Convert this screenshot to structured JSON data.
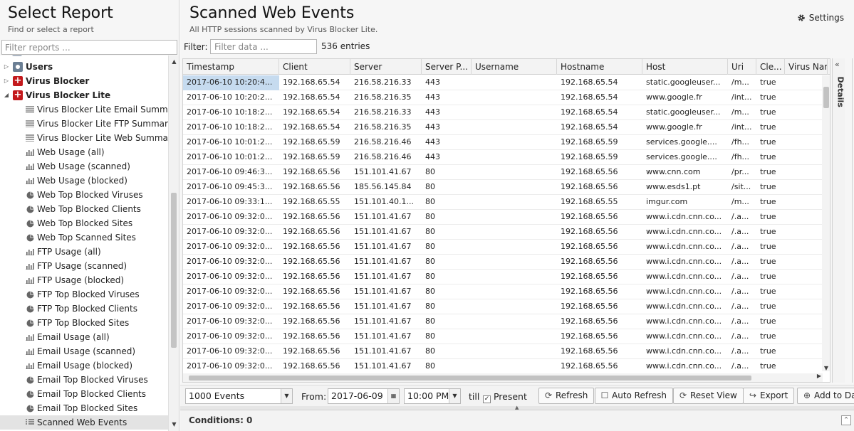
{
  "left": {
    "title": "Select Report",
    "subtitle": "Find or select a report",
    "filter_placeholder": "Filter reports ..."
  },
  "tree": [
    {
      "label": "Users",
      "type": "group",
      "icon": "users-icon",
      "expander": "▷"
    },
    {
      "label": "Virus Blocker",
      "type": "group",
      "icon": "virus-blocker-icon",
      "expander": "▷"
    },
    {
      "label": "Virus Blocker Lite",
      "type": "group",
      "icon": "virus-blocker-icon",
      "expander": "◢"
    },
    {
      "label": "Virus Blocker Lite Email Summary",
      "type": "text",
      "icon": "text-report-icon"
    },
    {
      "label": "Virus Blocker Lite FTP Summary",
      "type": "text",
      "icon": "text-report-icon"
    },
    {
      "label": "Virus Blocker Lite Web Summary",
      "type": "text",
      "icon": "text-report-icon"
    },
    {
      "label": "Web Usage (all)",
      "type": "bar",
      "icon": "bar-chart-icon"
    },
    {
      "label": "Web Usage (scanned)",
      "type": "bar",
      "icon": "bar-chart-icon"
    },
    {
      "label": "Web Usage (blocked)",
      "type": "bar",
      "icon": "bar-chart-icon"
    },
    {
      "label": "Web Top Blocked Viruses",
      "type": "pie",
      "icon": "pie-chart-icon"
    },
    {
      "label": "Web Top Blocked Clients",
      "type": "pie",
      "icon": "pie-chart-icon"
    },
    {
      "label": "Web Top Blocked Sites",
      "type": "pie",
      "icon": "pie-chart-icon"
    },
    {
      "label": "Web Top Scanned Sites",
      "type": "pie",
      "icon": "pie-chart-icon"
    },
    {
      "label": "FTP Usage (all)",
      "type": "bar",
      "icon": "bar-chart-icon"
    },
    {
      "label": "FTP Usage (scanned)",
      "type": "bar",
      "icon": "bar-chart-icon"
    },
    {
      "label": "FTP Usage (blocked)",
      "type": "bar",
      "icon": "bar-chart-icon"
    },
    {
      "label": "FTP Top Blocked Viruses",
      "type": "pie",
      "icon": "pie-chart-icon"
    },
    {
      "label": "FTP Top Blocked Clients",
      "type": "pie",
      "icon": "pie-chart-icon"
    },
    {
      "label": "FTP Top Blocked Sites",
      "type": "pie",
      "icon": "pie-chart-icon"
    },
    {
      "label": "Email Usage (all)",
      "type": "bar",
      "icon": "bar-chart-icon"
    },
    {
      "label": "Email Usage (scanned)",
      "type": "bar",
      "icon": "bar-chart-icon"
    },
    {
      "label": "Email Usage (blocked)",
      "type": "bar",
      "icon": "bar-chart-icon"
    },
    {
      "label": "Email Top Blocked Viruses",
      "type": "pie",
      "icon": "pie-chart-icon"
    },
    {
      "label": "Email Top Blocked Clients",
      "type": "pie",
      "icon": "pie-chart-icon"
    },
    {
      "label": "Email Top Blocked Sites",
      "type": "pie",
      "icon": "pie-chart-icon"
    },
    {
      "label": "Scanned Web Events",
      "type": "list",
      "icon": "list-icon",
      "selected": true
    }
  ],
  "main": {
    "title": "Scanned Web Events",
    "subtitle": "All HTTP sessions scanned by Virus Blocker Lite.",
    "settings_label": "Settings",
    "filter_label": "Filter:",
    "filter_placeholder": "Filter data ...",
    "entries": "536 entries",
    "details_label": "Details"
  },
  "columns": [
    "Timestamp",
    "Client",
    "Server",
    "Server P...",
    "Username",
    "Hostname",
    "Host",
    "Uri",
    "Cle...",
    "Virus Nam"
  ],
  "rows": [
    [
      "2017-06-10 10:20:4...",
      "192.168.65.54",
      "216.58.216.33",
      "443",
      "",
      "192.168.65.54",
      "static.googleuser...",
      "/m...",
      "true",
      ""
    ],
    [
      "2017-06-10 10:20:2...",
      "192.168.65.54",
      "216.58.216.35",
      "443",
      "",
      "192.168.65.54",
      "www.google.fr",
      "/int...",
      "true",
      ""
    ],
    [
      "2017-06-10 10:18:2...",
      "192.168.65.54",
      "216.58.216.33",
      "443",
      "",
      "192.168.65.54",
      "static.googleuser...",
      "/m...",
      "true",
      ""
    ],
    [
      "2017-06-10 10:18:2...",
      "192.168.65.54",
      "216.58.216.35",
      "443",
      "",
      "192.168.65.54",
      "www.google.fr",
      "/int...",
      "true",
      ""
    ],
    [
      "2017-06-10 10:01:2...",
      "192.168.65.59",
      "216.58.216.46",
      "443",
      "",
      "192.168.65.59",
      "services.google....",
      "/fh...",
      "true",
      ""
    ],
    [
      "2017-06-10 10:01:2...",
      "192.168.65.59",
      "216.58.216.46",
      "443",
      "",
      "192.168.65.59",
      "services.google....",
      "/fh...",
      "true",
      ""
    ],
    [
      "2017-06-10 09:46:3...",
      "192.168.65.56",
      "151.101.41.67",
      "80",
      "",
      "192.168.65.56",
      "www.cnn.com",
      "/pr...",
      "true",
      ""
    ],
    [
      "2017-06-10 09:45:3...",
      "192.168.65.56",
      "185.56.145.84",
      "80",
      "",
      "192.168.65.56",
      "www.esds1.pt",
      "/sit...",
      "true",
      ""
    ],
    [
      "2017-06-10 09:33:1...",
      "192.168.65.55",
      "151.101.40.1...",
      "80",
      "",
      "192.168.65.55",
      "imgur.com",
      "/m...",
      "true",
      ""
    ],
    [
      "2017-06-10 09:32:0...",
      "192.168.65.56",
      "151.101.41.67",
      "80",
      "",
      "192.168.65.56",
      "www.i.cdn.cnn.co...",
      "/.a...",
      "true",
      ""
    ],
    [
      "2017-06-10 09:32:0...",
      "192.168.65.56",
      "151.101.41.67",
      "80",
      "",
      "192.168.65.56",
      "www.i.cdn.cnn.co...",
      "/.a...",
      "true",
      ""
    ],
    [
      "2017-06-10 09:32:0...",
      "192.168.65.56",
      "151.101.41.67",
      "80",
      "",
      "192.168.65.56",
      "www.i.cdn.cnn.co...",
      "/.a...",
      "true",
      ""
    ],
    [
      "2017-06-10 09:32:0...",
      "192.168.65.56",
      "151.101.41.67",
      "80",
      "",
      "192.168.65.56",
      "www.i.cdn.cnn.co...",
      "/.a...",
      "true",
      ""
    ],
    [
      "2017-06-10 09:32:0...",
      "192.168.65.56",
      "151.101.41.67",
      "80",
      "",
      "192.168.65.56",
      "www.i.cdn.cnn.co...",
      "/.a...",
      "true",
      ""
    ],
    [
      "2017-06-10 09:32:0...",
      "192.168.65.56",
      "151.101.41.67",
      "80",
      "",
      "192.168.65.56",
      "www.i.cdn.cnn.co...",
      "/.a...",
      "true",
      ""
    ],
    [
      "2017-06-10 09:32:0...",
      "192.168.65.56",
      "151.101.41.67",
      "80",
      "",
      "192.168.65.56",
      "www.i.cdn.cnn.co...",
      "/.a...",
      "true",
      ""
    ],
    [
      "2017-06-10 09:32:0...",
      "192.168.65.56",
      "151.101.41.67",
      "80",
      "",
      "192.168.65.56",
      "www.i.cdn.cnn.co...",
      "/.a...",
      "true",
      ""
    ],
    [
      "2017-06-10 09:32:0...",
      "192.168.65.56",
      "151.101.41.67",
      "80",
      "",
      "192.168.65.56",
      "www.i.cdn.cnn.co...",
      "/.a...",
      "true",
      ""
    ],
    [
      "2017-06-10 09:32:0...",
      "192.168.65.56",
      "151.101.41.67",
      "80",
      "",
      "192.168.65.56",
      "www.i.cdn.cnn.co...",
      "/.a...",
      "true",
      ""
    ],
    [
      "2017-06-10 09:32:0...",
      "192.168.65.56",
      "151.101.41.67",
      "80",
      "",
      "192.168.65.56",
      "www.i.cdn.cnn.co...",
      "/.a...",
      "true",
      ""
    ]
  ],
  "toolbar": {
    "limit_value": "1000 Events",
    "from_label": "From:",
    "from_date": "2017-06-09",
    "from_time": "10:00 PM",
    "till_label": "till",
    "present_label": "Present",
    "present_checked": true,
    "refresh_label": "Refresh",
    "auto_refresh_label": "Auto Refresh",
    "reset_view_label": "Reset View",
    "export_label": "Export",
    "add_to_dashboard_label": "Add to Da"
  },
  "conditions": {
    "label": "Conditions: 0"
  },
  "colors": {
    "selected_cell": "#c6dbef",
    "virus_blocker_icon": "#c3191c"
  }
}
